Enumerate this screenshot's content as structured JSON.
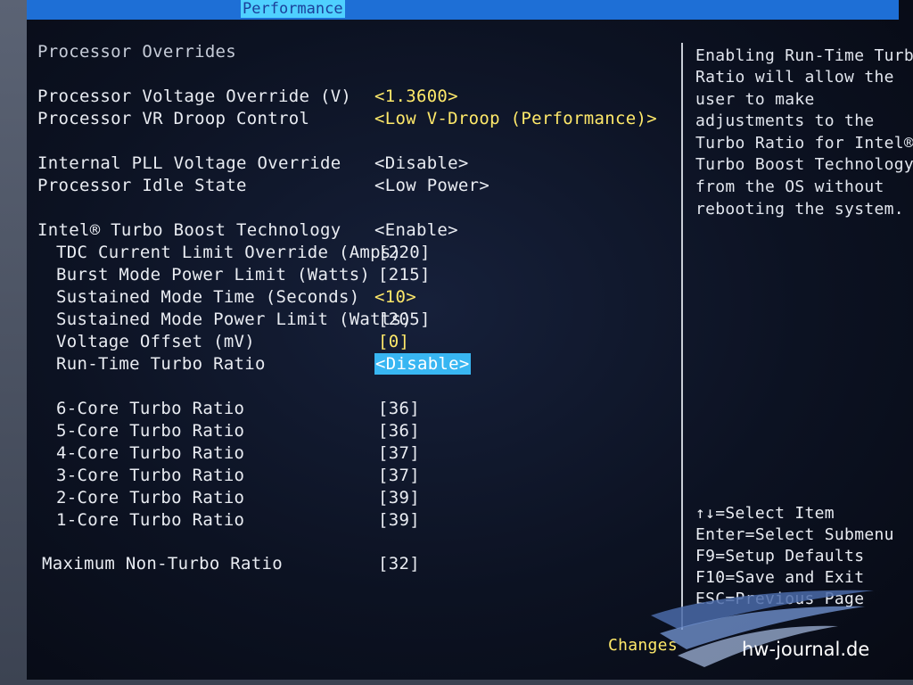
{
  "topbar": {
    "active_tab": "Performance"
  },
  "section_title": "Processor Overrides",
  "settings": [
    {
      "label": "Processor Voltage Override (V)",
      "value": "<1.3600>"
    },
    {
      "label": "Processor VR Droop Control",
      "value": "<Low V-Droop (Performance)>"
    },
    {
      "label": "Internal PLL Voltage Override",
      "value": "<Disable>"
    },
    {
      "label": "Processor Idle State",
      "value": "<Low Power>"
    },
    {
      "label": "Intel® Turbo Boost Technology",
      "value": "<Enable>"
    },
    {
      "label": "TDC Current Limit Override (Amps)",
      "value": "[220]"
    },
    {
      "label": "Burst Mode Power Limit (Watts)",
      "value": "[215]"
    },
    {
      "label": "Sustained Mode Time (Seconds)",
      "value": "<10>"
    },
    {
      "label": "Sustained Mode Power Limit (Watts)",
      "value": "[205]"
    },
    {
      "label": "Voltage Offset (mV)",
      "value": "[0]"
    },
    {
      "label": "Run-Time Turbo Ratio",
      "value": "<Disable>"
    },
    {
      "label": "6-Core Turbo Ratio",
      "value": "[36]"
    },
    {
      "label": "5-Core Turbo Ratio",
      "value": "[36]"
    },
    {
      "label": "4-Core Turbo Ratio",
      "value": "[37]"
    },
    {
      "label": "3-Core Turbo Ratio",
      "value": "[37]"
    },
    {
      "label": "2-Core Turbo Ratio",
      "value": "[39]"
    },
    {
      "label": "1-Core Turbo Ratio",
      "value": "[39]"
    },
    {
      "label": "Maximum Non-Turbo Ratio",
      "value": "[32]"
    }
  ],
  "help": {
    "lines": [
      "Enabling Run-Time Turbo",
      "Ratio will allow the",
      "user to make",
      "adjustments to the",
      "Turbo Ratio for Intel®",
      "Turbo Boost Technology",
      "from the OS without",
      "rebooting the system."
    ]
  },
  "keys": [
    "↑↓=Select Item",
    "Enter=Select Submenu",
    "F9=Setup Defaults",
    "F10=Save and Exit",
    "ESC=Previous Page"
  ],
  "footer": {
    "changes": "Changes"
  },
  "watermark": {
    "text": "hw-journal.de"
  },
  "colors": {
    "topbar": "#1e6fd6",
    "active_tab_bg": "#4fd0ff",
    "selected_value_bg": "#38b6f2",
    "value_yellow": "#ffe96a",
    "label_white": "#e9ecf2"
  }
}
